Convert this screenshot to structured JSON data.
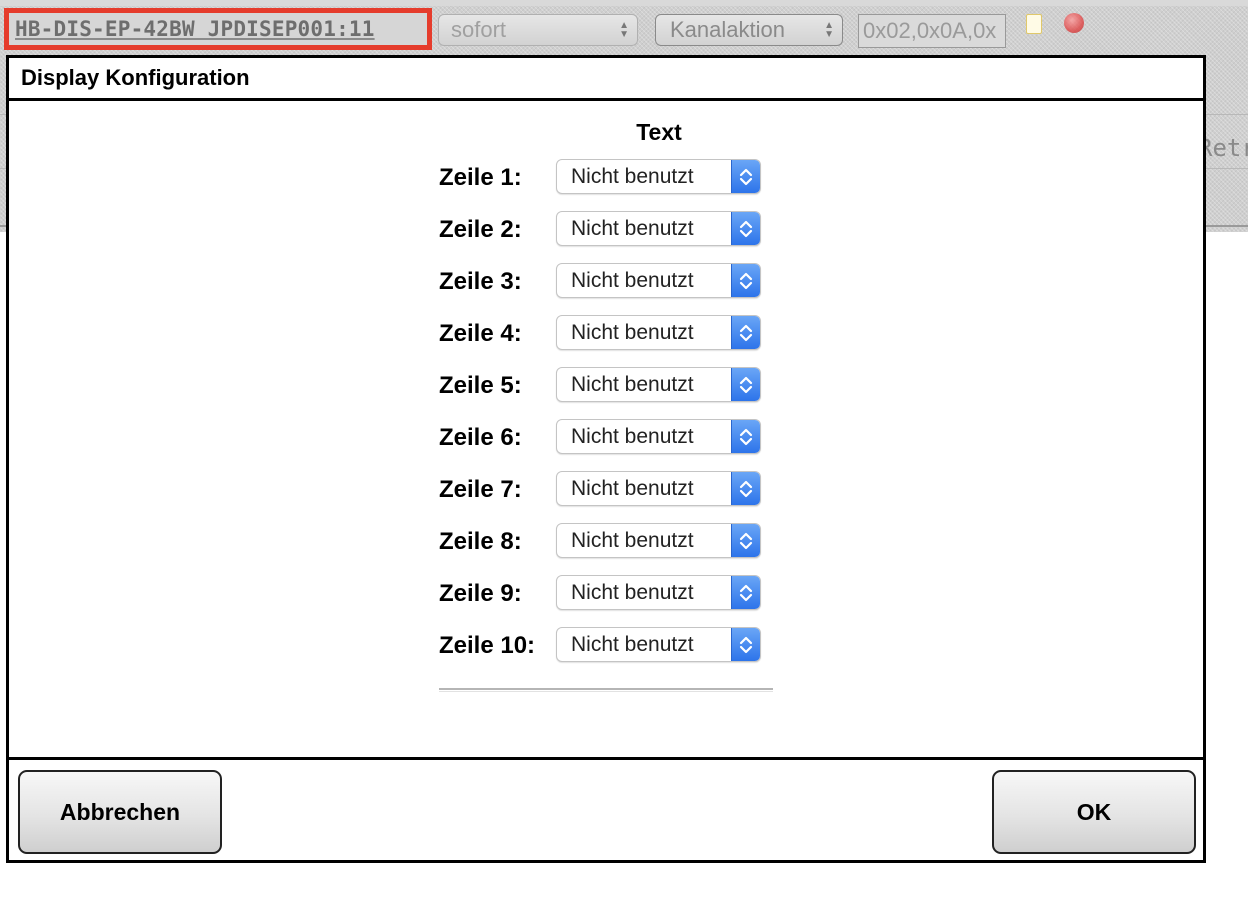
{
  "background": {
    "device_name": "HB-DIS-EP-42BW JPDISEP001:11",
    "timing_select": "sofort",
    "action_select": "Kanalaktion",
    "hex_value": "0x02,0x0A,0x",
    "right_fragment": "Retri",
    "highlight_color": "#e53c2c"
  },
  "dialog": {
    "title": "Display Konfiguration",
    "column_heading": "Text",
    "rows": [
      {
        "label": "Zeile 1:",
        "value": "Nicht benutzt"
      },
      {
        "label": "Zeile 2:",
        "value": "Nicht benutzt"
      },
      {
        "label": "Zeile 3:",
        "value": "Nicht benutzt"
      },
      {
        "label": "Zeile 4:",
        "value": "Nicht benutzt"
      },
      {
        "label": "Zeile 5:",
        "value": "Nicht benutzt"
      },
      {
        "label": "Zeile 6:",
        "value": "Nicht benutzt"
      },
      {
        "label": "Zeile 7:",
        "value": "Nicht benutzt"
      },
      {
        "label": "Zeile 8:",
        "value": "Nicht benutzt"
      },
      {
        "label": "Zeile 9:",
        "value": "Nicht benutzt"
      },
      {
        "label": "Zeile 10:",
        "value": "Nicht benutzt"
      }
    ],
    "select_accent": "#2d74ea",
    "cancel_label": "Abbrechen",
    "ok_label": "OK"
  }
}
